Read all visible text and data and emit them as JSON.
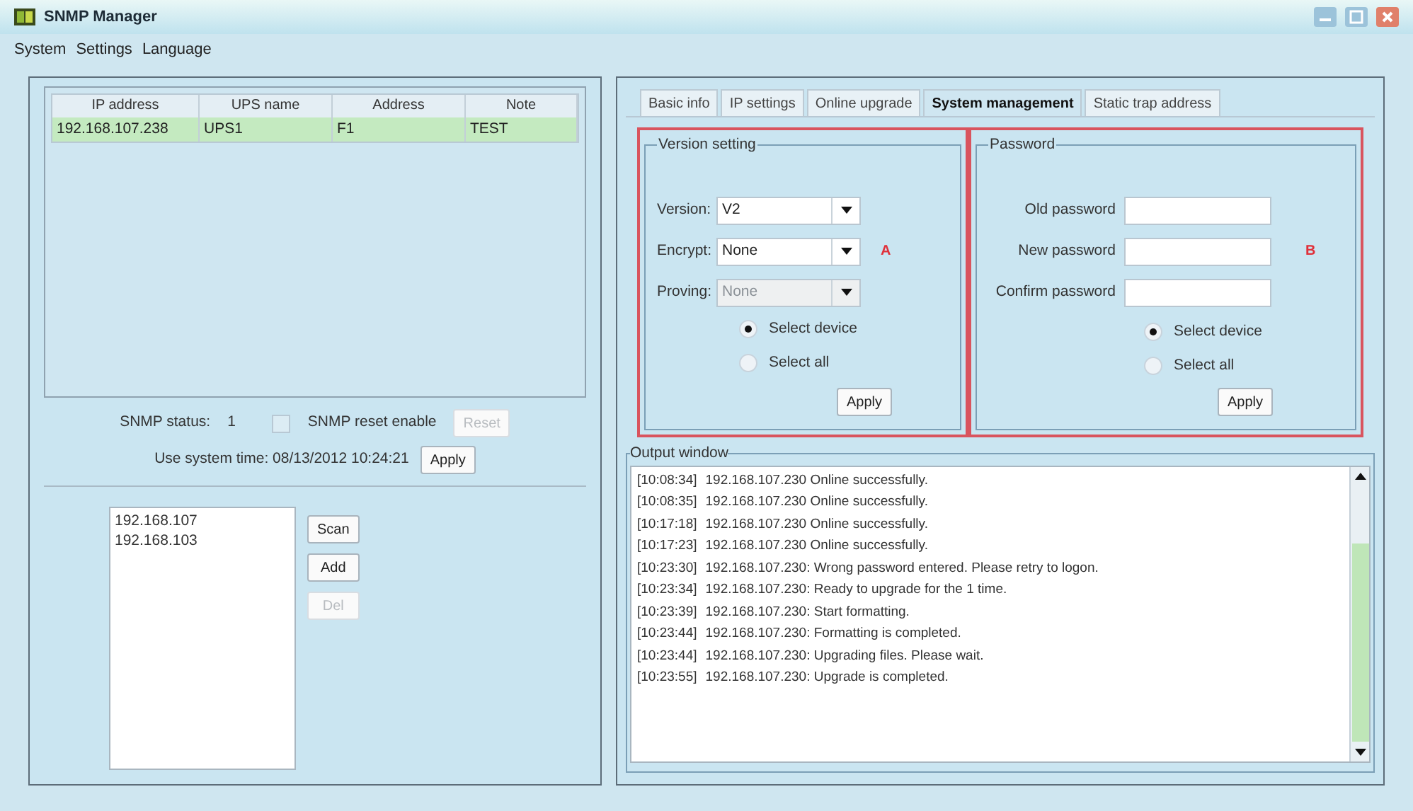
{
  "window": {
    "title": "SNMP Manager"
  },
  "menu": [
    "System",
    "Settings",
    "Language"
  ],
  "device_table": {
    "columns": [
      "IP address",
      "UPS name",
      "Address",
      "Note"
    ],
    "rows": [
      {
        "cells": [
          "192.168.107.238",
          "UPS1",
          "F1",
          "TEST"
        ],
        "selected": true
      }
    ]
  },
  "snmp_status": {
    "label": "SNMP status:",
    "value": "1"
  },
  "reset_enable": {
    "label": "SNMP reset enable",
    "checked": false
  },
  "reset_button": {
    "label": "Reset",
    "disabled": true
  },
  "system_time": {
    "label": "Use system time: 08/13/2012 10:24:21",
    "button": "Apply"
  },
  "ip_list": {
    "items": [
      "192.168.107",
      "192.168.103"
    ],
    "buttons": [
      {
        "label": "Scan",
        "disabled": false
      },
      {
        "label": "Add",
        "disabled": false
      },
      {
        "label": "Del",
        "disabled": true
      }
    ]
  },
  "tabs": [
    {
      "label": "Basic info",
      "selected": false
    },
    {
      "label": "IP settings",
      "selected": false
    },
    {
      "label": "Online upgrade",
      "selected": false
    },
    {
      "label": "System management",
      "selected": true
    },
    {
      "label": "Static trap address",
      "selected": false
    }
  ],
  "version_setting": {
    "title": "Version setting",
    "marker": "A",
    "fields": [
      {
        "label": "Version:",
        "value": "V2",
        "disabled": false
      },
      {
        "label": "Encrypt:",
        "value": "None",
        "disabled": false
      },
      {
        "label": "Proving:",
        "value": "None",
        "disabled": true
      }
    ],
    "radios": [
      {
        "label": "Select device",
        "selected": true
      },
      {
        "label": "Select all",
        "selected": false
      }
    ],
    "button": "Apply"
  },
  "password": {
    "title": "Password",
    "marker": "B",
    "fields": [
      {
        "label": "Old password"
      },
      {
        "label": "New password"
      },
      {
        "label": "Confirm password"
      }
    ],
    "radios": [
      {
        "label": "Select device",
        "selected": true
      },
      {
        "label": "Select all",
        "selected": false
      }
    ],
    "button": "Apply"
  },
  "output_window": {
    "title": "Output window",
    "lines": [
      {
        "time": "[10:08:34]",
        "message": "192.168.107.230 Online successfully."
      },
      {
        "time": "[10:08:35]",
        "message": "192.168.107.230 Online successfully."
      },
      {
        "time": "[10:17:18]",
        "message": "192.168.107.230 Online successfully."
      },
      {
        "time": "[10:17:23]",
        "message": "192.168.107.230 Online successfully."
      },
      {
        "time": "[10:23:30]",
        "message": "192.168.107.230: Wrong password entered. Please retry to logon."
      },
      {
        "time": "[10:23:34]",
        "message": "192.168.107.230: Ready to upgrade for the 1 time."
      },
      {
        "time": "[10:23:39]",
        "message": "192.168.107.230: Start formatting."
      },
      {
        "time": "[10:23:44]",
        "message": "192.168.107.230: Formatting is completed."
      },
      {
        "time": "[10:23:44]",
        "message": "192.168.107.230: Upgrading files. Please wait."
      },
      {
        "time": "[10:23:55]",
        "message": "192.168.107.230: Upgrade is completed."
      }
    ]
  }
}
